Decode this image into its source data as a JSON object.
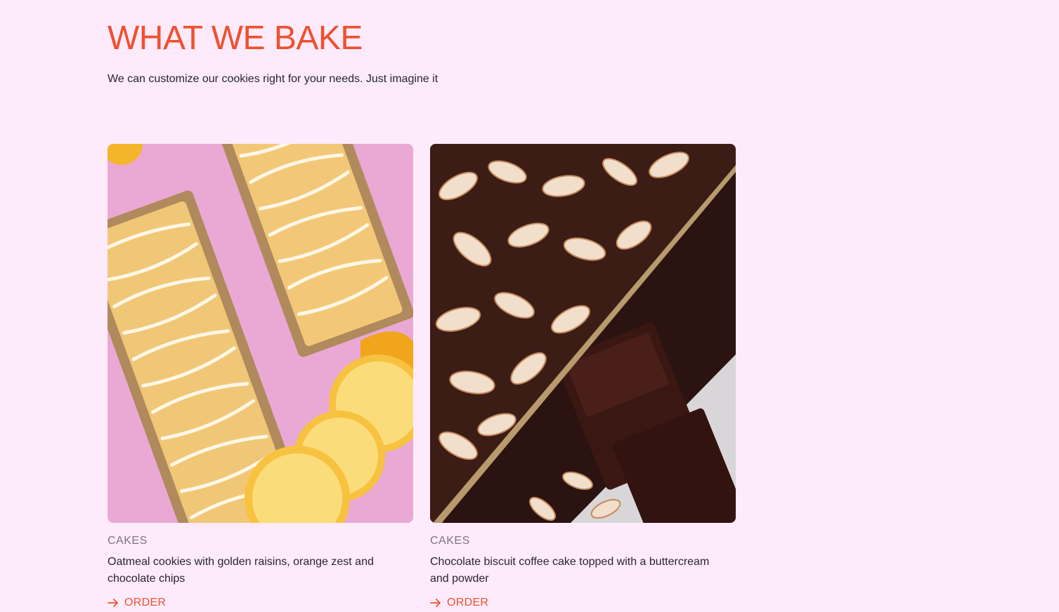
{
  "header": {
    "title": "WHAT WE BAKE",
    "subtitle": "We can customize our cookies right for your needs. Just imagine it"
  },
  "colors": {
    "background": "#fdebfb",
    "accent": "#f0502f",
    "text": "#2b2330",
    "muted": "#7d7386"
  },
  "cards": [
    {
      "category": "CAKES",
      "description": "Oatmeal cookies with golden raisins, orange zest and chocolate chips",
      "action": "ORDER",
      "image": "lemon-loaf-cakes-photo"
    },
    {
      "category": "CAKES",
      "description": "Chocolate biscuit coffee cake topped with a buttercream and powder",
      "action": "ORDER",
      "image": "almond-chocolate-cake-photo"
    }
  ]
}
